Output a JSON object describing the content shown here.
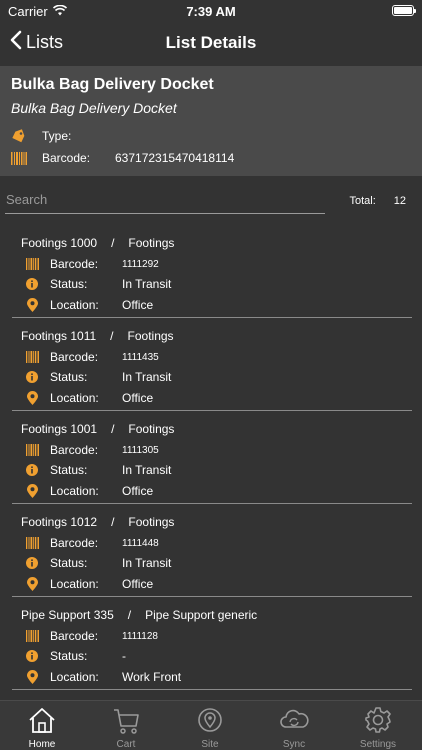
{
  "status_bar": {
    "carrier": "Carrier",
    "time": "7:39 AM"
  },
  "nav": {
    "back_label": "Lists",
    "title": "List Details"
  },
  "header": {
    "title": "Bulka Bag Delivery Docket",
    "subtitle": "Bulka Bag Delivery Docket",
    "type_label": "Type:",
    "type_value": "",
    "barcode_label": "Barcode:",
    "barcode_value": "637172315470418114"
  },
  "search": {
    "placeholder": "Search",
    "total_label": "Total:",
    "total_value": "12"
  },
  "labels": {
    "barcode": "Barcode:",
    "status": "Status:",
    "location": "Location:",
    "separator": "/"
  },
  "items": [
    {
      "name": "Footings 1000",
      "category": "Footings",
      "barcode": "1111292",
      "status": "In Transit",
      "location": "Office"
    },
    {
      "name": "Footings 1011",
      "category": "Footings",
      "barcode": "1111435",
      "status": "In Transit",
      "location": "Office"
    },
    {
      "name": "Footings 1001",
      "category": "Footings",
      "barcode": "1111305",
      "status": "In Transit",
      "location": "Office"
    },
    {
      "name": "Footings 1012",
      "category": "Footings",
      "barcode": "1111448",
      "status": "In Transit",
      "location": "Office"
    },
    {
      "name": "Pipe Support 335",
      "category": "Pipe Support generic",
      "barcode": "1111128",
      "status": "-",
      "location": "Work Front"
    }
  ],
  "tabs": [
    {
      "label": "Home",
      "icon": "home-icon",
      "active": true
    },
    {
      "label": "Cart",
      "icon": "cart-icon",
      "active": false
    },
    {
      "label": "Site",
      "icon": "site-icon",
      "active": false
    },
    {
      "label": "Sync",
      "icon": "sync-icon",
      "active": false
    },
    {
      "label": "Settings",
      "icon": "gear-icon",
      "active": false
    }
  ],
  "colors": {
    "accent": "#f0a030",
    "background": "#333333",
    "header_bg": "#4a4a4a"
  }
}
